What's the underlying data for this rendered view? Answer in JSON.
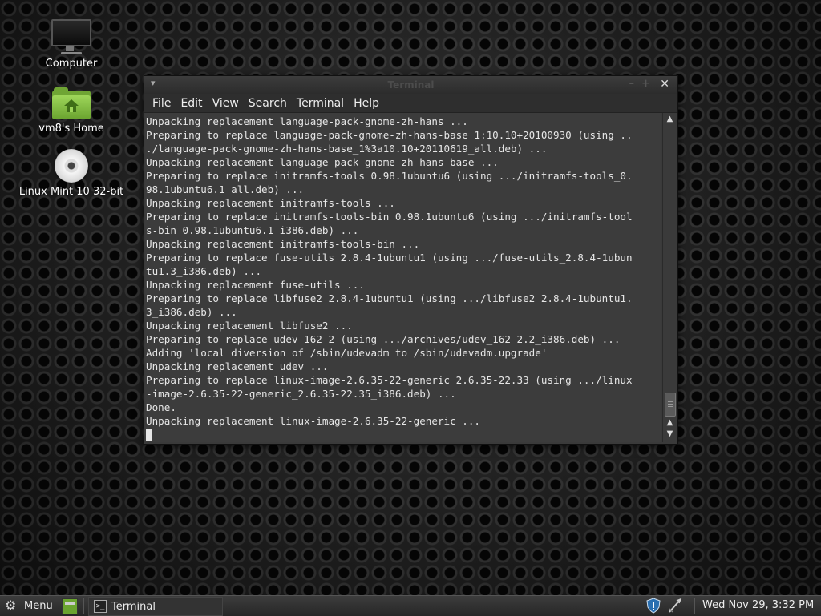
{
  "desktop": {
    "icons": [
      {
        "label": "Computer",
        "icon": "computer-icon"
      },
      {
        "label": "vm8's Home",
        "icon": "home-folder-icon"
      },
      {
        "label": "Linux Mint 10 32-bit",
        "icon": "cd-disc-icon"
      }
    ]
  },
  "window": {
    "title": "Terminal",
    "controls": {
      "minimize": "–",
      "maximize": "+",
      "close": "✕",
      "window_menu": "▾"
    },
    "menu": [
      "File",
      "Edit",
      "View",
      "Search",
      "Terminal",
      "Help"
    ],
    "terminal_output": "Unpacking replacement language-pack-gnome-zh-hans ...\nPreparing to replace language-pack-gnome-zh-hans-base 1:10.10+20100930 (using ..\n./language-pack-gnome-zh-hans-base_1%3a10.10+20110619_all.deb) ...\nUnpacking replacement language-pack-gnome-zh-hans-base ...\nPreparing to replace initramfs-tools 0.98.1ubuntu6 (using .../initramfs-tools_0.\n98.1ubuntu6.1_all.deb) ...\nUnpacking replacement initramfs-tools ...\nPreparing to replace initramfs-tools-bin 0.98.1ubuntu6 (using .../initramfs-tool\ns-bin_0.98.1ubuntu6.1_i386.deb) ...\nUnpacking replacement initramfs-tools-bin ...\nPreparing to replace fuse-utils 2.8.4-1ubuntu1 (using .../fuse-utils_2.8.4-1ubun\ntu1.3_i386.deb) ...\nUnpacking replacement fuse-utils ...\nPreparing to replace libfuse2 2.8.4-1ubuntu1 (using .../libfuse2_2.8.4-1ubuntu1.\n3_i386.deb) ...\nUnpacking replacement libfuse2 ...\nPreparing to replace udev 162-2 (using .../archives/udev_162-2.2_i386.deb) ...\nAdding 'local diversion of /sbin/udevadm to /sbin/udevadm.upgrade'\nUnpacking replacement udev ...\nPreparing to replace linux-image-2.6.35-22-generic 2.6.35-22.33 (using .../linux\n-image-2.6.35-22-generic_2.6.35-22.35_i386.deb) ...\nDone.\nUnpacking replacement linux-image-2.6.35-22-generic ...\n"
  },
  "panel": {
    "menu_label": "Menu",
    "task_label": "Terminal",
    "clock": "Wed Nov 29,  3:32 PM"
  },
  "colors": {
    "terminal_bg": "#3c3c3c",
    "terminal_fg": "#e6e6e6",
    "panel_bg": "#2e2e2e",
    "folder_green": "#6fa534"
  }
}
